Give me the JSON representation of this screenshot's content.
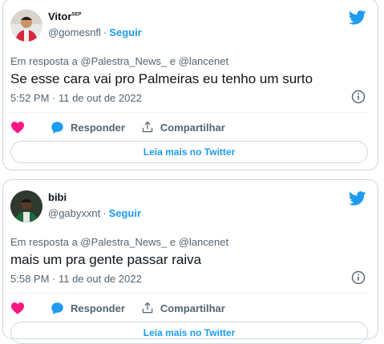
{
  "colors": {
    "accent": "#1d9bf0",
    "like": "#f91880",
    "text": "#0f1419",
    "muted": "#536471",
    "border": "#cfd9de"
  },
  "tweets": [
    {
      "name": "Vitor",
      "name_badge": "SEP",
      "handle": "@gomesnfl",
      "separator": "·",
      "follow": "Seguir",
      "reply_to": "Em resposta a @Palestra_News_ e @lancenet",
      "text": "Se esse cara vai pro Palmeiras eu tenho um surto",
      "time": "5:52 PM · 11 de out de 2022",
      "reply_label": "Responder",
      "share_label": "Compartilhar",
      "read_more": "Leia mais no Twitter",
      "icons": [
        "twitter-bird-icon",
        "info-icon",
        "heart-icon",
        "reply-bubble-icon",
        "share-icon"
      ]
    },
    {
      "name": "bibi",
      "handle": "@gabyxxnt",
      "separator": "·",
      "follow": "Seguir",
      "reply_to": "Em resposta a @Palestra_News_ e @lancenet",
      "text": "mais um pra gente passar raiva",
      "time": "5:58 PM · 11 de out de 2022",
      "reply_label": "Responder",
      "share_label": "Compartilhar",
      "read_more": "Leia mais no Twitter",
      "icons": [
        "twitter-bird-icon",
        "info-icon",
        "heart-icon",
        "reply-bubble-icon",
        "share-icon"
      ]
    }
  ]
}
